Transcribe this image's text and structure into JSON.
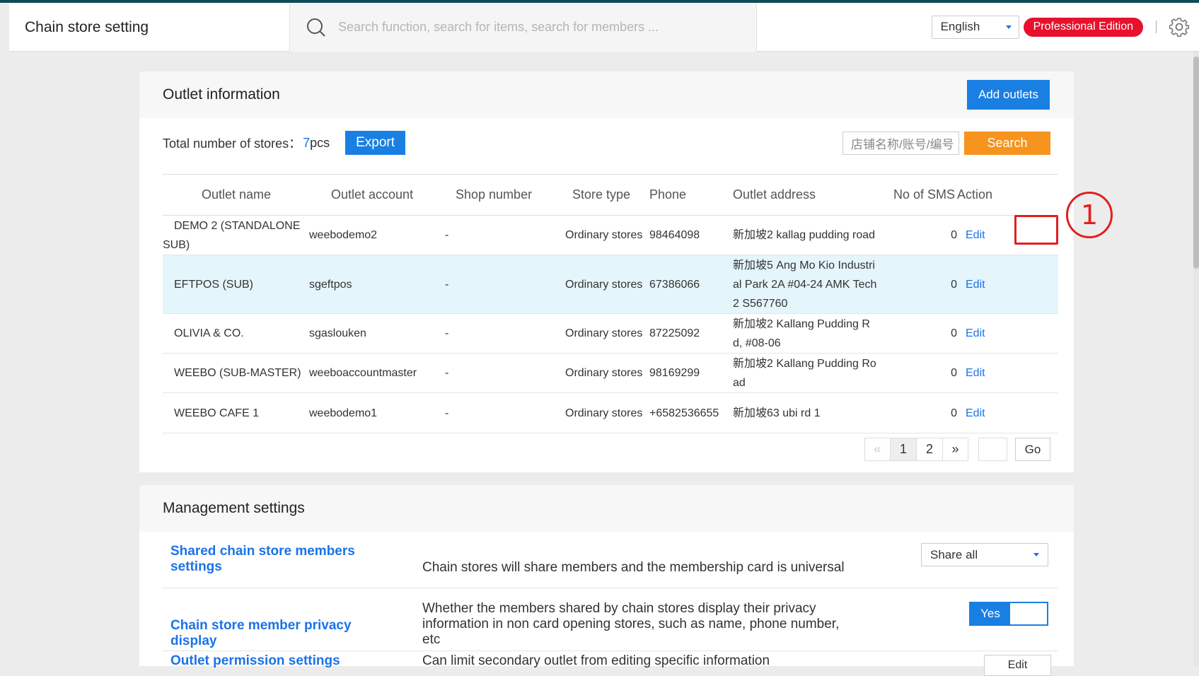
{
  "header": {
    "title": "Chain store setting",
    "search_placeholder": "Search function, search for items, search for members ...",
    "language": "English",
    "edition_badge": "Professional Edition",
    "separator": "|"
  },
  "outlet_panel": {
    "title": "Outlet information",
    "add_button": "Add outlets",
    "total_label": "Total number of stores：",
    "total_count": "7",
    "total_unit": "pcs",
    "export_button": "Export",
    "store_search_placeholder": "店铺名称/账号/编号",
    "search_button": "Search",
    "columns": [
      "Outlet name",
      "Outlet account",
      "Shop number",
      "Store type",
      "Phone",
      "Outlet address",
      "No of SMS",
      "Action"
    ],
    "rows": [
      {
        "name": "DEMO 2 (STANDALONE SUB)",
        "account": "weebodemo2",
        "shop": "-",
        "type": "Ordinary stores",
        "phone": "98464098",
        "address": "新加坡2 kallag pudding road",
        "sms": "0",
        "action": "Edit"
      },
      {
        "name": "EFTPOS (SUB)",
        "account": "sgeftpos",
        "shop": "-",
        "type": "Ordinary stores",
        "phone": "67386066",
        "address": "新加坡5 Ang Mo Kio Industrial Park 2A #04-24 AMK Tech 2 S567760",
        "sms": "0",
        "action": "Edit"
      },
      {
        "name": "OLIVIA & CO.",
        "account": "sgaslouken",
        "shop": "-",
        "type": "Ordinary stores",
        "phone": "87225092",
        "address": "新加坡2 Kallang Pudding Rd, #08-06",
        "sms": "0",
        "action": "Edit"
      },
      {
        "name": "WEEBO (SUB-MASTER)",
        "account": "weeboaccountmaster",
        "shop": "-",
        "type": "Ordinary stores",
        "phone": "98169299",
        "address": "新加坡2 Kallang Pudding Road",
        "sms": "0",
        "action": "Edit"
      },
      {
        "name": "WEEBO CAFE 1",
        "account": "weebodemo1",
        "shop": "-",
        "type": "Ordinary stores",
        "phone": "+6582536655",
        "address": "新加坡63 ubi rd 1",
        "sms": "0",
        "action": "Edit"
      }
    ],
    "pager": {
      "prev": "«",
      "pages": [
        "1",
        "2"
      ],
      "current": "1",
      "next": "»",
      "go": "Go"
    }
  },
  "annotation": {
    "marker": "1",
    "color": "#e0201f"
  },
  "management": {
    "title": "Management settings",
    "items": [
      {
        "title": "Shared chain store members settings",
        "desc": "Chain stores will share members and the membership card is universal",
        "control": "Share all"
      },
      {
        "title": "Chain store member privacy display",
        "desc": "Whether the members shared by chain stores display their privacy information in non card opening stores, such as name, phone number, etc",
        "control": "Yes"
      },
      {
        "title": "Outlet permission settings",
        "desc": "Can limit secondary outlet from editing specific information",
        "control": "Edit"
      }
    ]
  },
  "colors": {
    "accent": "#1a7fe3",
    "badge": "#e8102c",
    "search_btn": "#f7941d",
    "topbar": "#0f4a57",
    "highlight_row": "#e4f5fb"
  }
}
